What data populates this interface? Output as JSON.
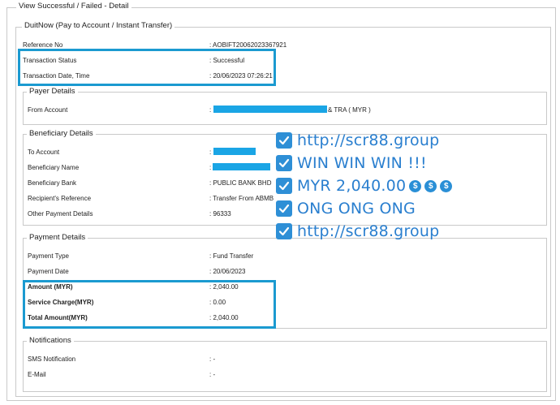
{
  "outer_legend": "View Successful / Failed - Detail",
  "duitnow_legend": "DuitNow (Pay to Account / Instant Transfer)",
  "reference_no": {
    "label": "Reference No",
    "value": ": AOBIFT20062023367921"
  },
  "transaction_status": {
    "label": "Transaction Status",
    "value": ": Successful"
  },
  "transaction_datetime": {
    "label": "Transaction Date, Time",
    "value": ": 20/06/2023 07:26:21"
  },
  "payer": {
    "legend": "Payer Details",
    "from_account": {
      "label": "From Account",
      "value_prefix": ":",
      "value_suffix": "& TRA ( MYR )"
    }
  },
  "beneficiary": {
    "legend": "Beneficiary Details",
    "to_account": {
      "label": "To Account",
      "value_prefix": ":"
    },
    "beneficiary_name": {
      "label": "Beneficiary Name",
      "value_prefix": ":"
    },
    "beneficiary_bank": {
      "label": "Beneficiary Bank",
      "value": ": PUBLIC BANK BHD"
    },
    "recipient_reference": {
      "label": "Recipient's Reference",
      "value": ": Transfer From ABMB"
    },
    "other_payment_details": {
      "label": "Other Payment Details",
      "value": ": 96333"
    }
  },
  "payment": {
    "legend": "Payment Details",
    "payment_type": {
      "label": "Payment Type",
      "value": ": Fund Transfer"
    },
    "payment_date": {
      "label": "Payment Date",
      "value": ": 20/06/2023"
    },
    "amount": {
      "label": "Amount (MYR)",
      "value": ": 2,040.00"
    },
    "service_charge": {
      "label": "Service Charge(MYR)",
      "value": ": 0.00"
    },
    "total_amount": {
      "label": "Total Amount(MYR)",
      "value": ": 2,040.00"
    }
  },
  "notifications": {
    "legend": "Notifications",
    "sms": {
      "label": "SMS Notification",
      "value": ": -"
    },
    "email": {
      "label": "E-Mail",
      "value": ": -"
    }
  },
  "overlay_lines": [
    "http://scr88.group",
    "WIN WIN WIN !!!",
    "MYR 2,040.00",
    "ONG ONG ONG",
    "http://scr88.group"
  ],
  "colors": {
    "highlight": "#1b9ad0",
    "redaction": "#1aa5e5",
    "overlay_text": "#2a7fcf",
    "checkbox": "#2e8fd6"
  },
  "icons": {
    "check": "check-icon",
    "coin": "money-bag-icon"
  }
}
